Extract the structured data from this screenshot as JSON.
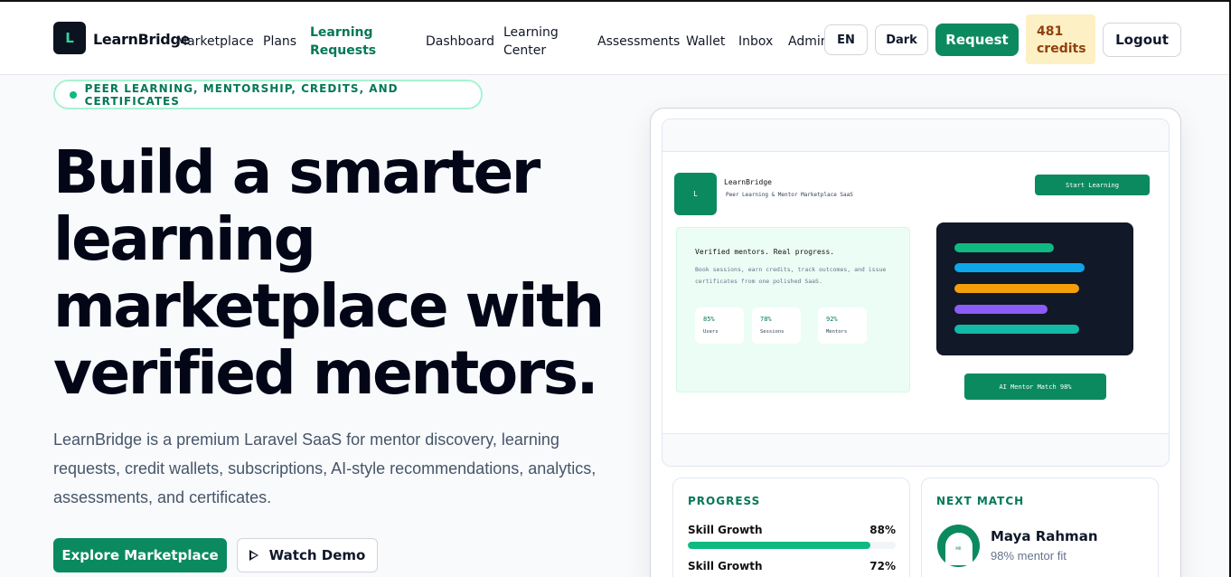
{
  "nav": {
    "logo_letter": "L",
    "brand": "LearnBridge",
    "links": [
      "Marketplace",
      "Plans",
      "Learning Requests",
      "Dashboard",
      "Learning Center",
      "Assessments",
      "Wallet",
      "Inbox",
      "Admin"
    ],
    "lang": "EN",
    "theme": "Dark",
    "request": "Request",
    "credits_value": "481",
    "credits_label": "credits",
    "logout": "Logout"
  },
  "hero": {
    "pill": "PEER LEARNING, MENTORSHIP, CREDITS, AND CERTIFICATES",
    "title": "Build a smarter learning marketplace with verified mentors.",
    "description": "LearnBridge is a premium Laravel SaaS for mentor discovery, learning requests, credit wallets, subscriptions, AI-style recommendations, analytics, assessments, and certificates.",
    "primary_cta": "Explore Marketplace",
    "secondary_cta": "Watch Demo"
  },
  "preview": {
    "logo_letter": "L",
    "brand": "LearnBridge",
    "tagline": "Peer Learning & Mentor Marketplace SaaS",
    "start": "Start Learning",
    "panel_title": "Verified mentors. Real progress.",
    "panel_desc": "Book sessions, earn credits, track outcomes, and issue certificates from one polished SaaS.",
    "stats": [
      {
        "value": "85%",
        "label": "Users"
      },
      {
        "value": "78%",
        "label": "Sessions"
      },
      {
        "value": "92%",
        "label": "Mentors"
      }
    ],
    "code_colors": [
      "#10b981",
      "#0ea5e9",
      "#f59e0b",
      "#8b5cf6",
      "#14b8a6"
    ],
    "match_btn": "AI Mentor Match 98%"
  },
  "progress": {
    "heading": "PROGRESS",
    "items": [
      {
        "label": "Skill Growth",
        "pct": "88%",
        "value": 88
      },
      {
        "label": "Skill Growth",
        "pct": "72%",
        "value": 72
      }
    ]
  },
  "next_match": {
    "heading": "NEXT MATCH",
    "avatar_text": "MR",
    "name": "Maya Rahman",
    "fit": "98% mentor fit"
  },
  "colors": {
    "brand_green": "#0b8a5f",
    "accent_text": "#047857",
    "credits_bg": "#fdf0c4"
  }
}
